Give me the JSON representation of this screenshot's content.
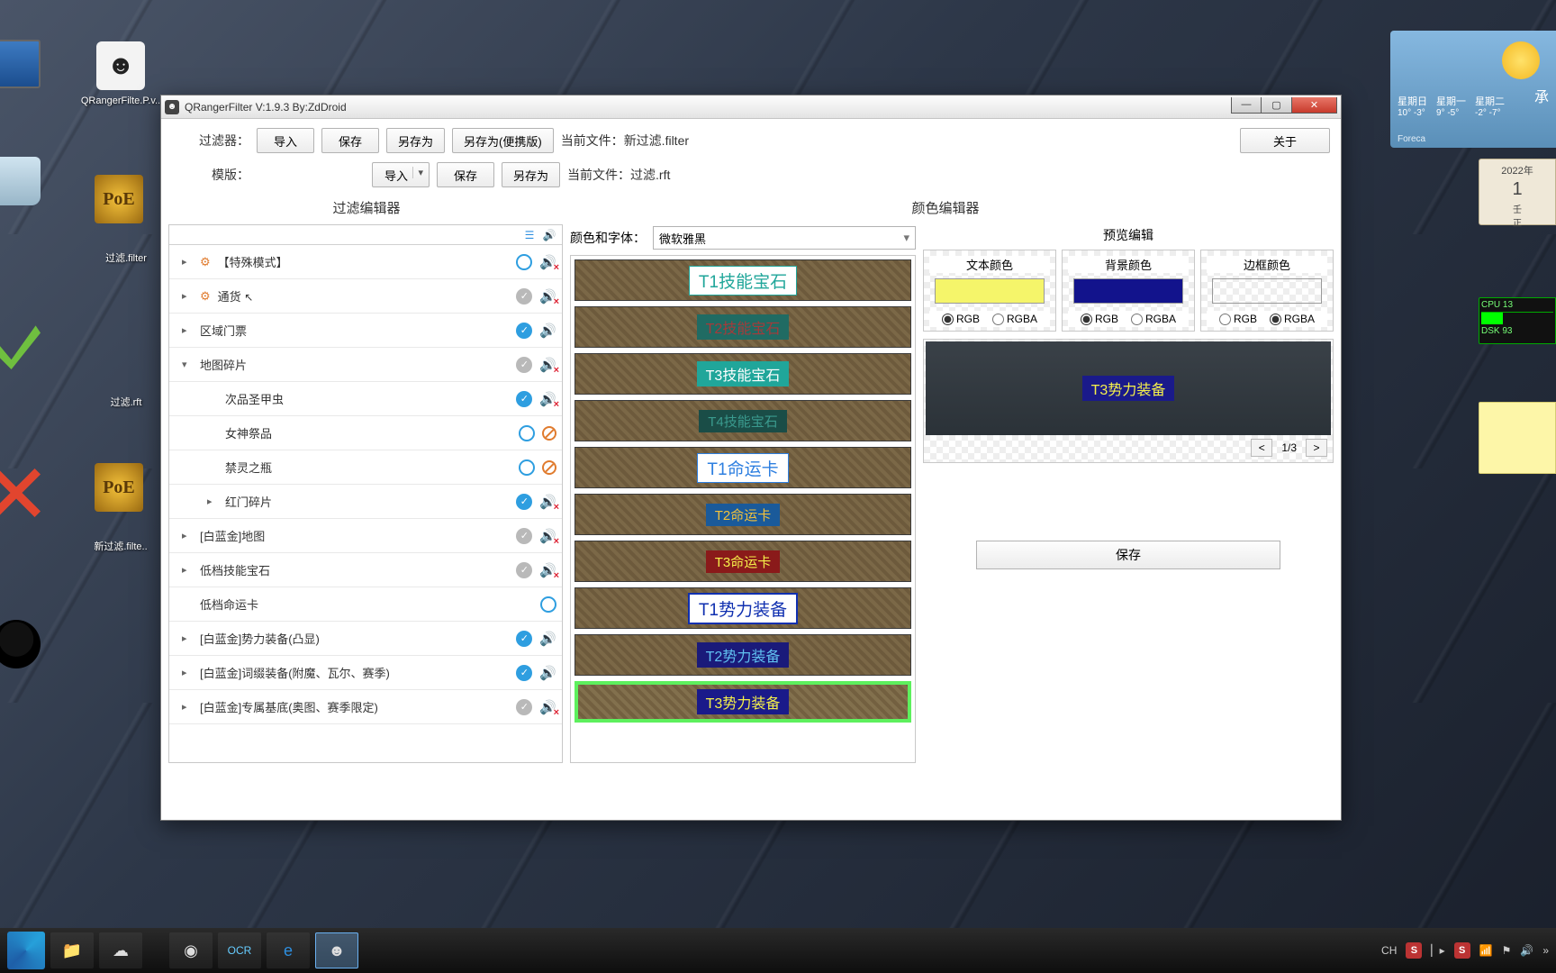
{
  "desktop": {
    "app_label": "QRangerFilte.P.v..",
    "txt1": "过滤.filter",
    "txt2": "过滤.rft",
    "txt3": "新过滤.filte..",
    "poe": "PoE"
  },
  "window": {
    "title": "QRangerFilter  V:1.9.3  By:ZdDroid"
  },
  "toolbar": {
    "filter_label": "过滤器：",
    "import": "导入",
    "save": "保存",
    "saveas": "另存为",
    "saveas_portable": "另存为(便携版)",
    "current_file_label": "当前文件：",
    "current_filter": "新过滤.filter",
    "template_label": "模版：",
    "current_template": "过滤.rft",
    "about": "关于"
  },
  "panels": {
    "left": "过滤编辑器",
    "right": "颜色编辑器"
  },
  "tree": [
    {
      "label": "【特殊模式】",
      "indent": 0,
      "chev": "▸",
      "gear": true,
      "status": "ring",
      "sound": "mute"
    },
    {
      "label": "通货",
      "indent": 0,
      "chev": "▸",
      "gear": true,
      "status": "gray",
      "sound": "mute",
      "cursor": true
    },
    {
      "label": "区域门票",
      "indent": 0,
      "chev": "▸",
      "status": "on",
      "sound": "on"
    },
    {
      "label": "地图碎片",
      "indent": 0,
      "chev": "▾",
      "status": "gray",
      "sound": "mute"
    },
    {
      "label": "次品圣甲虫",
      "indent": 1,
      "status": "on",
      "sound": "mute"
    },
    {
      "label": "女神祭品",
      "indent": 1,
      "status": "ring",
      "forbid": true
    },
    {
      "label": "禁灵之瓶",
      "indent": 1,
      "status": "ring",
      "forbid": true
    },
    {
      "label": "红门碎片",
      "indent": 1,
      "chev": "▸",
      "status": "on",
      "sound": "mute"
    },
    {
      "label": "[白蓝金]地图",
      "indent": 0,
      "chev": "▸",
      "status": "gray",
      "sound": "mute"
    },
    {
      "label": "低档技能宝石",
      "indent": 0,
      "chev": "▸",
      "status": "gray",
      "sound": "mute"
    },
    {
      "label": "低档命运卡",
      "indent": 0,
      "status": "ring"
    },
    {
      "label": "[白蓝金]势力装备(凸显)",
      "indent": 0,
      "chev": "▸",
      "status": "on",
      "sound": "on"
    },
    {
      "label": "[白蓝金]词缀装备(附魔、瓦尔、赛季)",
      "indent": 0,
      "chev": "▸",
      "status": "on",
      "sound": "on"
    },
    {
      "label": "[白蓝金]专属基底(奥图、赛季限定)",
      "indent": 0,
      "chev": "▸",
      "status": "gray",
      "sound": "mute"
    }
  ],
  "mid": {
    "label": "颜色和字体：",
    "font": "微软雅黑",
    "items": [
      {
        "cls": "t1gem",
        "text": "T1技能宝石"
      },
      {
        "cls": "t2gem",
        "text": "T2技能宝石"
      },
      {
        "cls": "t3gem",
        "text": "T3技能宝石"
      },
      {
        "cls": "t4gem",
        "text": "T4技能宝石"
      },
      {
        "cls": "t1fate",
        "text": "T1命运卡"
      },
      {
        "cls": "t2fate",
        "text": "T2命运卡"
      },
      {
        "cls": "t3fate",
        "text": "T3命运卡"
      },
      {
        "cls": "t1eq",
        "text": "T1势力装备"
      },
      {
        "cls": "t2eq",
        "text": "T2势力装备"
      },
      {
        "cls": "t3eq",
        "text": "T3势力装备",
        "sel": true
      }
    ]
  },
  "right": {
    "title": "预览编辑",
    "text_color": {
      "label": "文本颜色",
      "value": "#f5f56a",
      "mode": "RGB"
    },
    "bg_color": {
      "label": "背景颜色",
      "value": "#12138c",
      "mode": "RGB"
    },
    "border_color": {
      "label": "边框颜色",
      "value": "transparent",
      "mode": "RGBA"
    },
    "rgb": "RGB",
    "rgba": "RGBA",
    "preview_text": "T3势力装备",
    "pager": "1/3",
    "save": "保存"
  },
  "gadgets": {
    "weather_loc": "承",
    "weather_days": [
      "星期日",
      "星期一",
      "星期二"
    ],
    "weather_temps": [
      "10° -3°",
      "9° -5°",
      "-2° -7°"
    ],
    "foreca": "Foreca",
    "cal_year": "2022年",
    "cal_extra1": "壬",
    "cal_extra2": "正",
    "cpu": "CPU  13",
    "dsk": "DSK  93"
  },
  "tray": {
    "ime": "CH",
    "s": "S"
  }
}
